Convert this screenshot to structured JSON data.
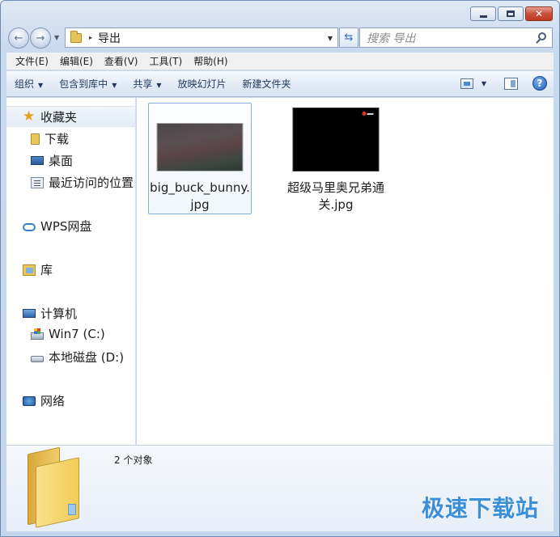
{
  "window": {
    "caption_buttons": {
      "minimize": "",
      "maximize": "",
      "close": "✕"
    }
  },
  "address_bar": {
    "path": "导出",
    "separator": "▸"
  },
  "search": {
    "placeholder": "搜索 导出"
  },
  "menu": [
    "文件(E)",
    "编辑(E)",
    "查看(V)",
    "工具(T)",
    "帮助(H)"
  ],
  "toolbar": {
    "organize": "组织",
    "include_in_library": "包含到库中",
    "share": "共享",
    "slideshow": "放映幻灯片",
    "new_folder": "新建文件夹",
    "help": "?"
  },
  "nav_pane": {
    "favorites": "收藏夹",
    "downloads": "下载",
    "desktop": "桌面",
    "recent": "最近访问的位置",
    "wps_drive": "WPS网盘",
    "libraries": "库",
    "computer": "计算机",
    "drive_c": "Win7 (C:)",
    "drive_d": "本地磁盘 (D:)",
    "network": "网络"
  },
  "files": [
    {
      "name": "big_buck_bunny.jpg"
    },
    {
      "name": "超级马里奥兄弟通关.jpg"
    }
  ],
  "details": {
    "item_count": "2 个对象"
  },
  "watermark": "极速下载站"
}
